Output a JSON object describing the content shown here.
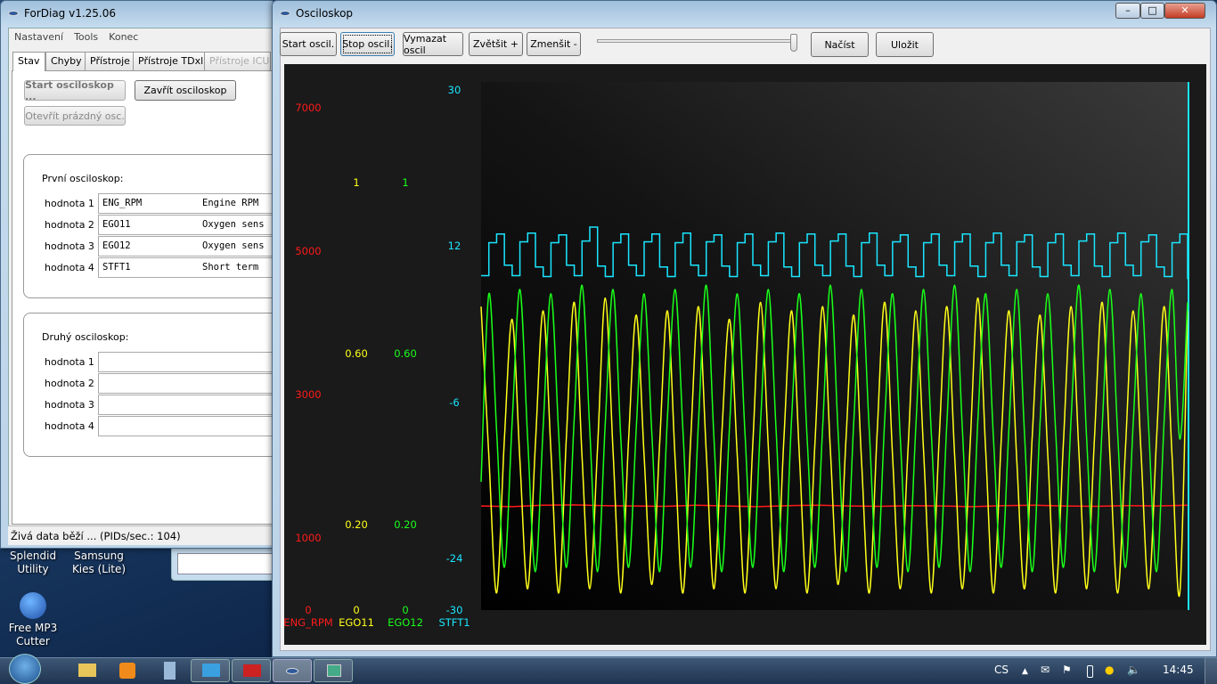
{
  "desktop": {
    "icons": [
      {
        "label": "Splendid\nUtility"
      },
      {
        "label": "Samsung\nKies (Lite)"
      },
      {
        "label": "Free MP3\nCutter"
      }
    ]
  },
  "fordiag": {
    "title": "ForDiag v1.25.06",
    "menu": [
      "Nastavení",
      "Tools",
      "Konec"
    ],
    "tabs": [
      {
        "label": "Stav"
      },
      {
        "label": "Chyby"
      },
      {
        "label": "Přístroje"
      },
      {
        "label": "Přístroje TDxl"
      },
      {
        "label": "Přístroje ICU",
        "disabled": true
      }
    ],
    "start_button": "Start osciloskop ...",
    "close_button": "Zavřít osciloskop",
    "open_empty_button": "Otevřít prázdný osc.",
    "group1": {
      "title": "První osciloskop:",
      "rows": [
        {
          "label": "hodnota 1",
          "pid": "ENG_RPM",
          "desc": "Engine RPM"
        },
        {
          "label": "hodnota 2",
          "pid": "EGO11",
          "desc": "Oxygen sens"
        },
        {
          "label": "hodnota 3",
          "pid": "EGO12",
          "desc": "Oxygen sens"
        },
        {
          "label": "hodnota 4",
          "pid": "STFT1",
          "desc": "Short term"
        }
      ]
    },
    "group2": {
      "title": "Druhý osciloskop:",
      "rows": [
        {
          "label": "hodnota 1",
          "pid": "",
          "desc": ""
        },
        {
          "label": "hodnota 2",
          "pid": "",
          "desc": ""
        },
        {
          "label": "hodnota 3",
          "pid": "",
          "desc": ""
        },
        {
          "label": "hodnota 4",
          "pid": "",
          "desc": ""
        }
      ]
    },
    "status": "Živá data běží ... (PIDs/sec.: 104)"
  },
  "osc": {
    "title": "Osciloskop",
    "buttons": {
      "start": "Start oscil.",
      "stop": "Stop oscil.",
      "clear": "Vymazat oscil",
      "zoom_in": "Zvětšit +",
      "zoom_out": "Zmenšit -",
      "load": "Načíst",
      "save": "Uložit"
    },
    "slider_value": 1.0
  },
  "chart_data": {
    "type": "line",
    "background": "#000000",
    "grid": false,
    "axes": [
      {
        "name": "ENG_RPM",
        "color": "#ff1a1a",
        "range": [
          0,
          8000
        ],
        "ticks": [
          {
            "v": 7000,
            "t": "7000"
          },
          {
            "v": 5000,
            "t": "5000"
          },
          {
            "v": 3000,
            "t": "3000"
          },
          {
            "v": 1000,
            "t": "1000"
          },
          {
            "v": 0,
            "t": "0"
          }
        ]
      },
      {
        "name": "EGO11",
        "color": "#ffff1a",
        "range": [
          0,
          1.344
        ],
        "ticks": [
          {
            "v": 1,
            "t": "1"
          },
          {
            "v": 0.6,
            "t": "0.60"
          },
          {
            "v": 0.2,
            "t": "0.20"
          },
          {
            "v": 0,
            "t": "0"
          }
        ]
      },
      {
        "name": "EGO12",
        "color": "#1aff1a",
        "range": [
          0,
          1.344
        ],
        "ticks": [
          {
            "v": 1,
            "t": "1"
          },
          {
            "v": 0.6,
            "t": "0.60"
          },
          {
            "v": 0.2,
            "t": "0.20"
          },
          {
            "v": 0,
            "t": "0"
          }
        ]
      },
      {
        "name": "STFT1",
        "color": "#1ae6ff",
        "range": [
          -30,
          36.3
        ],
        "ticks": [
          {
            "v": 30,
            "t": "30"
          },
          {
            "v": 12,
            "t": "12"
          },
          {
            "v": -6,
            "t": "-6"
          },
          {
            "v": -24,
            "t": "-24"
          },
          {
            "v": -30,
            "t": "-30"
          }
        ]
      }
    ],
    "series": [
      {
        "name": "ENG_RPM",
        "axis": 0,
        "style": "line",
        "values": [
          1450,
          1440,
          1460,
          1465,
          1455,
          1450,
          1445,
          1460,
          1450,
          1440,
          1455,
          1460,
          1450,
          1445,
          1455,
          1450,
          1440,
          1455,
          1460,
          1450,
          1445,
          1455,
          1450,
          1460
        ]
      },
      {
        "name": "EGO11",
        "axis": 1,
        "style": "smooth",
        "values": [
          0.71,
          0.36,
          0.04,
          0.4,
          0.68,
          0.35,
          0.05,
          0.39,
          0.7,
          0.37,
          0.04,
          0.41,
          0.72,
          0.36,
          0.05,
          0.38,
          0.73,
          0.37,
          0.04,
          0.4,
          0.69,
          0.36,
          0.06,
          0.39,
          0.7,
          0.35,
          0.04,
          0.4,
          0.71,
          0.37,
          0.05,
          0.41,
          0.68,
          0.36,
          0.04,
          0.39,
          0.72,
          0.38,
          0.05,
          0.4,
          0.7,
          0.36,
          0.04,
          0.39,
          0.71,
          0.37,
          0.06,
          0.4,
          0.69,
          0.35,
          0.04,
          0.41,
          0.72,
          0.36,
          0.05,
          0.38,
          0.7,
          0.37,
          0.04,
          0.4,
          0.71,
          0.36,
          0.05,
          0.39,
          0.73,
          0.37,
          0.04,
          0.4,
          0.7,
          0.35,
          0.05,
          0.41,
          0.69,
          0.36,
          0.04,
          0.39,
          0.71,
          0.37,
          0.05,
          0.4,
          0.72,
          0.36,
          0.04,
          0.38,
          0.7,
          0.37,
          0.05,
          0.4,
          0.71,
          0.36,
          0.04,
          0.7
        ]
      },
      {
        "name": "EGO12",
        "axis": 2,
        "style": "smooth",
        "values": [
          0.3,
          0.74,
          0.42,
          0.1,
          0.44,
          0.75,
          0.4,
          0.09,
          0.43,
          0.74,
          0.41,
          0.1,
          0.45,
          0.76,
          0.42,
          0.09,
          0.44,
          0.75,
          0.4,
          0.1,
          0.43,
          0.74,
          0.41,
          0.09,
          0.45,
          0.75,
          0.42,
          0.1,
          0.44,
          0.76,
          0.4,
          0.09,
          0.43,
          0.74,
          0.41,
          0.1,
          0.44,
          0.75,
          0.42,
          0.09,
          0.45,
          0.74,
          0.4,
          0.1,
          0.43,
          0.76,
          0.41,
          0.09,
          0.44,
          0.75,
          0.42,
          0.1,
          0.45,
          0.74,
          0.4,
          0.09,
          0.43,
          0.75,
          0.41,
          0.1,
          0.44,
          0.76,
          0.42,
          0.09,
          0.45,
          0.74,
          0.4,
          0.1,
          0.43,
          0.75,
          0.41,
          0.09,
          0.44,
          0.74,
          0.42,
          0.1,
          0.45,
          0.76,
          0.4,
          0.09,
          0.43,
          0.75,
          0.41,
          0.1,
          0.44,
          0.74,
          0.42,
          0.09,
          0.45,
          0.75,
          0.4,
          0.72
        ]
      },
      {
        "name": "STFT1",
        "axis": 3,
        "style": "step",
        "values": [
          8.6,
          12.4,
          13.4,
          9.8,
          8.6,
          12.5,
          13.5,
          9.6,
          8.5,
          12.4,
          13.3,
          9.8,
          8.6,
          12.6,
          14.2,
          9.7,
          8.5,
          12.4,
          13.4,
          9.8,
          8.6,
          12.5,
          13.4,
          9.6,
          8.5,
          12.4,
          13.5,
          9.8,
          8.6,
          12.5,
          13.3,
          9.7,
          8.5,
          12.4,
          13.4,
          9.8,
          8.6,
          12.5,
          13.5,
          9.6,
          8.5,
          12.4,
          13.4,
          9.8,
          8.6,
          12.6,
          13.4,
          9.7,
          8.5,
          12.4,
          13.5,
          9.8,
          8.6,
          12.5,
          13.3,
          9.6,
          8.5,
          12.4,
          13.4,
          9.8,
          8.6,
          12.5,
          13.4,
          9.7,
          8.5,
          12.4,
          13.5,
          9.8,
          8.6,
          12.5,
          13.3,
          9.6,
          8.5,
          12.4,
          13.4,
          9.8,
          8.6,
          12.6,
          13.4,
          9.7,
          8.5,
          12.4,
          13.5,
          9.8,
          8.6,
          12.5,
          13.3,
          9.6,
          8.5,
          12.4,
          13.4,
          8.2
        ]
      }
    ]
  },
  "taskbar": {
    "language": "CS",
    "clock": "14:45"
  }
}
